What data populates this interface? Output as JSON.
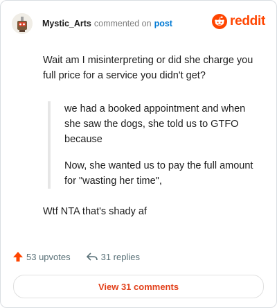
{
  "header": {
    "username": "Mystic_Arts",
    "action": "commented on",
    "post_link": "post",
    "brand": "reddit"
  },
  "comment": {
    "text": "Wait am I misinterpreting or did she charge you full price for a service you didn't get?",
    "quote": [
      "we had a booked appointment and when she saw the dogs, she told us to GTFO because",
      "Now, she wanted us to pay the full amount for \"wasting her time\","
    ],
    "after": "Wtf NTA that's shady af"
  },
  "stats": {
    "upvotes": "53 upvotes",
    "replies": "31 replies"
  },
  "view_button": "View 31 comments",
  "colors": {
    "brand": "#ff4500",
    "link": "#0079d3",
    "button_text": "#e2411b"
  }
}
